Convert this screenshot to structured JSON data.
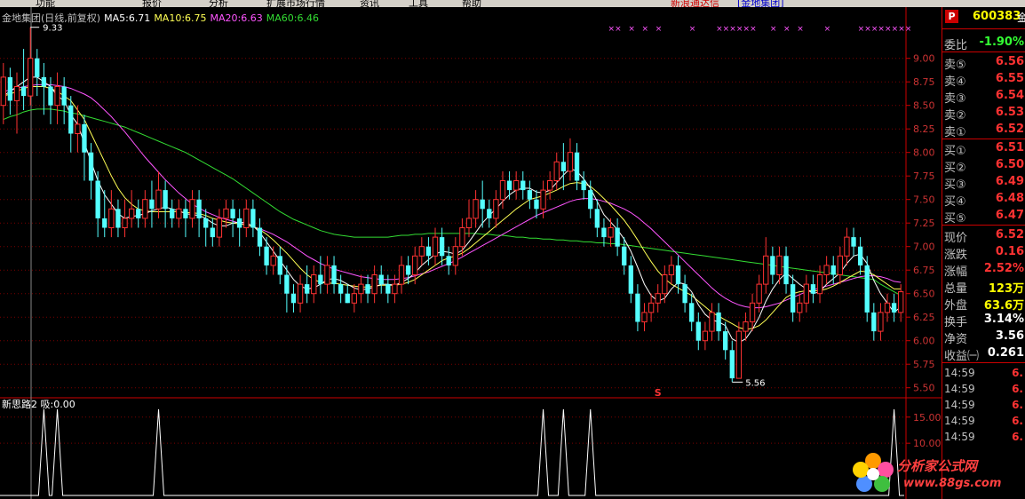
{
  "menubar": {
    "items": [
      "功能",
      "报价",
      "分析",
      "扩展市场行情",
      "资讯",
      "工具",
      "帮助"
    ],
    "notice": "新浪通达信",
    "notice2": "[金地集团]"
  },
  "chart_title": {
    "name": "金地集团(日线,前复权)",
    "ma5": "MA5:6.71",
    "ma10": "MA10:6.75",
    "ma20": "MA20:6.63",
    "ma60": "MA60:6.46"
  },
  "annotations": {
    "high_label": "9.33",
    "low_label": "5.56",
    "s_mark": "S"
  },
  "sub_title": "新思路2 吸:0.00",
  "quote": {
    "badge": "P",
    "code": "600383",
    "extra": "金",
    "wei_bi_label": "委比",
    "wei_bi_value": "-1.90%",
    "sell": [
      {
        "label": "卖⑤",
        "value": "6.56"
      },
      {
        "label": "卖④",
        "value": "6.55"
      },
      {
        "label": "卖③",
        "value": "6.54"
      },
      {
        "label": "卖②",
        "value": "6.53"
      },
      {
        "label": "卖①",
        "value": "6.52"
      }
    ],
    "buy": [
      {
        "label": "买①",
        "value": "6.51"
      },
      {
        "label": "买②",
        "value": "6.50"
      },
      {
        "label": "买③",
        "value": "6.49"
      },
      {
        "label": "买④",
        "value": "6.48"
      },
      {
        "label": "买⑤",
        "value": "6.47"
      }
    ],
    "stats": [
      {
        "label": "现价",
        "value": "6.52",
        "color": "#ff3232"
      },
      {
        "label": "涨跌",
        "value": "0.16",
        "color": "#ff3232"
      },
      {
        "label": "涨幅",
        "value": "2.52%",
        "color": "#ff3232"
      },
      {
        "label": "总量",
        "value": "123万",
        "color": "#ffff00"
      },
      {
        "label": "外盘",
        "value": "63.6万",
        "color": "#ffff00"
      },
      {
        "label": "换手",
        "value": "3.14%",
        "color": "#ffffff"
      },
      {
        "label": "净资",
        "value": "3.56",
        "color": "#ffffff"
      },
      {
        "label": "收益㈠",
        "value": "0.261",
        "color": "#ffffff"
      }
    ],
    "ticks": [
      {
        "time": "14:59",
        "price": "6."
      },
      {
        "time": "14:59",
        "price": "6."
      },
      {
        "time": "14:59",
        "price": "6."
      },
      {
        "time": "14:59",
        "price": "6."
      },
      {
        "time": "14:59",
        "price": "6."
      }
    ]
  },
  "watermark": {
    "name": "分析家公式网",
    "url": "www.88gs.com"
  },
  "chart_data": {
    "type": "candlestick",
    "price_axis": {
      "ticks": [
        "9.00",
        "8.75",
        "8.50",
        "8.25",
        "8.00",
        "7.75",
        "7.50",
        "7.25",
        "7.00",
        "6.75",
        "6.50",
        "6.25",
        "6.00",
        "5.75",
        "5.50"
      ],
      "ylim": [
        5.45,
        9.45
      ]
    },
    "indicator_axis": {
      "ticks": [
        "15.00",
        "10.00"
      ],
      "ylim": [
        0,
        17
      ]
    },
    "series_names": [
      "MA5",
      "MA10",
      "MA20",
      "MA60"
    ],
    "colors": {
      "up": "#ff3232",
      "down": "#54ffff",
      "ma5": "#ffffff",
      "ma10": "#ffff55",
      "ma20": "#ff55ff",
      "ma60": "#33dd33",
      "signal": "#ff55ff"
    },
    "candles": [
      [
        8.5,
        8.8,
        8.3,
        8.95
      ],
      [
        8.8,
        8.55,
        8.4,
        8.9
      ],
      [
        8.55,
        8.7,
        8.2,
        8.85
      ],
      [
        8.7,
        8.6,
        8.45,
        9.1
      ],
      [
        8.6,
        9.0,
        8.5,
        9.33
      ],
      [
        9.0,
        8.8,
        8.6,
        9.1
      ],
      [
        8.8,
        8.7,
        8.4,
        8.95
      ],
      [
        8.7,
        8.5,
        8.3,
        8.8
      ],
      [
        8.5,
        8.7,
        8.3,
        8.85
      ],
      [
        8.7,
        8.5,
        8.3,
        8.8
      ],
      [
        8.5,
        8.2,
        8.0,
        8.6
      ],
      [
        8.2,
        8.3,
        8.0,
        8.5
      ],
      [
        8.3,
        8.0,
        7.7,
        8.4
      ],
      [
        8.0,
        7.7,
        7.5,
        8.1
      ],
      [
        7.7,
        7.3,
        7.1,
        7.8
      ],
      [
        7.3,
        7.2,
        7.1,
        7.6
      ],
      [
        7.2,
        7.4,
        7.1,
        7.6
      ],
      [
        7.4,
        7.2,
        7.1,
        7.5
      ],
      [
        7.2,
        7.3,
        7.1,
        7.5
      ],
      [
        7.3,
        7.4,
        7.2,
        7.6
      ],
      [
        7.4,
        7.3,
        7.2,
        7.5
      ],
      [
        7.3,
        7.5,
        7.2,
        7.6
      ],
      [
        7.5,
        7.4,
        7.2,
        7.7
      ],
      [
        7.4,
        7.6,
        7.3,
        7.8
      ],
      [
        7.6,
        7.4,
        7.2,
        7.7
      ],
      [
        7.4,
        7.3,
        7.2,
        7.5
      ],
      [
        7.3,
        7.4,
        7.2,
        7.5
      ],
      [
        7.4,
        7.3,
        7.1,
        7.5
      ],
      [
        7.3,
        7.5,
        7.2,
        7.6
      ],
      [
        7.5,
        7.3,
        7.1,
        7.6
      ],
      [
        7.3,
        7.2,
        7.0,
        7.4
      ],
      [
        7.2,
        7.1,
        7.0,
        7.3
      ],
      [
        7.1,
        7.3,
        7.0,
        7.4
      ],
      [
        7.3,
        7.4,
        7.2,
        7.5
      ],
      [
        7.4,
        7.3,
        7.1,
        7.5
      ],
      [
        7.3,
        7.2,
        7.0,
        7.4
      ],
      [
        7.2,
        7.4,
        7.1,
        7.5
      ],
      [
        7.4,
        7.2,
        7.1,
        7.5
      ],
      [
        7.2,
        7.0,
        6.9,
        7.3
      ],
      [
        7.0,
        6.8,
        6.7,
        7.1
      ],
      [
        6.8,
        6.9,
        6.7,
        7.0
      ],
      [
        6.9,
        6.7,
        6.6,
        7.0
      ],
      [
        6.7,
        6.5,
        6.3,
        6.8
      ],
      [
        6.5,
        6.4,
        6.3,
        6.6
      ],
      [
        6.4,
        6.6,
        6.3,
        6.7
      ],
      [
        6.6,
        6.5,
        6.4,
        6.8
      ],
      [
        6.5,
        6.7,
        6.4,
        6.8
      ],
      [
        6.7,
        6.6,
        6.5,
        6.9
      ],
      [
        6.6,
        6.8,
        6.5,
        6.9
      ],
      [
        6.8,
        6.6,
        6.5,
        6.9
      ],
      [
        6.6,
        6.5,
        6.4,
        6.7
      ],
      [
        6.5,
        6.4,
        6.4,
        6.6
      ],
      [
        6.4,
        6.5,
        6.3,
        6.6
      ],
      [
        6.5,
        6.6,
        6.4,
        6.7
      ],
      [
        6.6,
        6.5,
        6.4,
        6.7
      ],
      [
        6.5,
        6.7,
        6.4,
        6.8
      ],
      [
        6.7,
        6.6,
        6.5,
        6.8
      ],
      [
        6.6,
        6.5,
        6.4,
        6.7
      ],
      [
        6.5,
        6.6,
        6.4,
        6.7
      ],
      [
        6.6,
        6.8,
        6.5,
        6.9
      ],
      [
        6.8,
        6.7,
        6.6,
        6.9
      ],
      [
        6.7,
        6.9,
        6.6,
        7.0
      ],
      [
        6.9,
        7.0,
        6.8,
        7.1
      ],
      [
        7.0,
        6.9,
        6.8,
        7.1
      ],
      [
        6.9,
        7.1,
        6.8,
        7.2
      ],
      [
        7.1,
        6.9,
        6.8,
        7.2
      ],
      [
        6.9,
        6.8,
        6.7,
        7.0
      ],
      [
        6.8,
        7.0,
        6.7,
        7.1
      ],
      [
        7.0,
        7.2,
        6.9,
        7.3
      ],
      [
        7.2,
        7.3,
        7.1,
        7.5
      ],
      [
        7.3,
        7.5,
        7.2,
        7.6
      ],
      [
        7.5,
        7.4,
        7.2,
        7.7
      ],
      [
        7.4,
        7.3,
        7.2,
        7.5
      ],
      [
        7.3,
        7.5,
        7.2,
        7.6
      ],
      [
        7.5,
        7.7,
        7.4,
        7.8
      ],
      [
        7.7,
        7.6,
        7.5,
        7.8
      ],
      [
        7.6,
        7.7,
        7.5,
        7.8
      ],
      [
        7.7,
        7.6,
        7.5,
        7.8
      ],
      [
        7.6,
        7.5,
        7.4,
        7.7
      ],
      [
        7.5,
        7.4,
        7.3,
        7.6
      ],
      [
        7.4,
        7.6,
        7.3,
        7.7
      ],
      [
        7.6,
        7.7,
        7.5,
        7.8
      ],
      [
        7.7,
        7.9,
        7.6,
        8.0
      ],
      [
        7.9,
        7.8,
        7.6,
        8.1
      ],
      [
        7.8,
        8.0,
        7.7,
        8.15
      ],
      [
        8.0,
        7.7,
        7.6,
        8.1
      ],
      [
        7.7,
        7.6,
        7.5,
        7.8
      ],
      [
        7.6,
        7.4,
        7.3,
        7.7
      ],
      [
        7.4,
        7.2,
        7.1,
        7.5
      ],
      [
        7.2,
        7.1,
        7.0,
        7.3
      ],
      [
        7.1,
        7.2,
        7.0,
        7.3
      ],
      [
        7.2,
        7.0,
        6.9,
        7.3
      ],
      [
        7.0,
        6.8,
        6.7,
        7.1
      ],
      [
        6.8,
        6.5,
        6.4,
        6.9
      ],
      [
        6.5,
        6.2,
        6.1,
        6.6
      ],
      [
        6.2,
        6.3,
        6.1,
        6.4
      ],
      [
        6.3,
        6.4,
        6.2,
        6.5
      ],
      [
        6.4,
        6.5,
        6.3,
        6.6
      ],
      [
        6.5,
        6.7,
        6.4,
        6.8
      ],
      [
        6.7,
        6.8,
        6.6,
        6.9
      ],
      [
        6.8,
        6.6,
        6.5,
        6.9
      ],
      [
        6.6,
        6.4,
        6.3,
        6.7
      ],
      [
        6.4,
        6.2,
        6.1,
        6.5
      ],
      [
        6.2,
        6.0,
        5.9,
        6.3
      ],
      [
        6.0,
        6.1,
        5.9,
        6.2
      ],
      [
        6.1,
        6.3,
        6.0,
        6.4
      ],
      [
        6.3,
        6.1,
        6.0,
        6.4
      ],
      [
        6.1,
        5.9,
        5.8,
        6.2
      ],
      [
        5.9,
        5.6,
        5.56,
        6.0
      ],
      [
        5.6,
        6.1,
        5.6,
        6.2
      ],
      [
        6.1,
        6.2,
        6.0,
        6.3
      ],
      [
        6.2,
        6.4,
        6.1,
        6.5
      ],
      [
        6.4,
        6.6,
        6.3,
        6.7
      ],
      [
        6.6,
        6.9,
        6.5,
        7.1
      ],
      [
        6.9,
        6.7,
        6.6,
        7.0
      ],
      [
        6.7,
        6.9,
        6.6,
        7.0
      ],
      [
        6.9,
        6.6,
        6.5,
        7.0
      ],
      [
        6.6,
        6.3,
        6.2,
        6.7
      ],
      [
        6.3,
        6.4,
        6.2,
        6.5
      ],
      [
        6.4,
        6.6,
        6.3,
        6.7
      ],
      [
        6.6,
        6.5,
        6.4,
        6.7
      ],
      [
        6.5,
        6.7,
        6.4,
        6.8
      ],
      [
        6.7,
        6.8,
        6.6,
        6.9
      ],
      [
        6.8,
        6.7,
        6.6,
        6.9
      ],
      [
        6.7,
        6.9,
        6.6,
        7.0
      ],
      [
        6.9,
        7.1,
        6.8,
        7.2
      ],
      [
        7.1,
        7.0,
        6.9,
        7.2
      ],
      [
        7.0,
        6.8,
        6.7,
        7.1
      ],
      [
        6.8,
        6.3,
        6.2,
        6.9
      ],
      [
        6.3,
        6.1,
        6.0,
        6.4
      ],
      [
        6.1,
        6.3,
        6.0,
        6.4
      ],
      [
        6.3,
        6.4,
        6.2,
        6.5
      ],
      [
        6.4,
        6.3,
        6.2,
        6.5
      ],
      [
        6.3,
        6.52,
        6.2,
        6.6
      ]
    ],
    "ma5": [
      8.6,
      8.65,
      8.7,
      8.75,
      8.8,
      8.8,
      8.75,
      8.7,
      8.6,
      8.55,
      8.4,
      8.3,
      8.1,
      7.9,
      7.7,
      7.55,
      7.45,
      7.35,
      7.3,
      7.32,
      7.33,
      7.35,
      7.38,
      7.4,
      7.42,
      7.4,
      7.38,
      7.35,
      7.34,
      7.33,
      7.3,
      7.25,
      7.22,
      7.22,
      7.25,
      7.26,
      7.25,
      7.22,
      7.15,
      7.05,
      6.95,
      6.85,
      6.75,
      6.65,
      6.58,
      6.55,
      6.56,
      6.6,
      6.65,
      6.66,
      6.64,
      6.6,
      6.56,
      6.54,
      6.55,
      6.57,
      6.6,
      6.6,
      6.59,
      6.62,
      6.66,
      6.72,
      6.8,
      6.86,
      6.92,
      6.95,
      6.94,
      6.92,
      6.96,
      7.05,
      7.15,
      7.25,
      7.33,
      7.4,
      7.48,
      7.55,
      7.6,
      7.62,
      7.62,
      7.58,
      7.57,
      7.6,
      7.68,
      7.76,
      7.83,
      7.8,
      7.72,
      7.62,
      7.48,
      7.34,
      7.26,
      7.18,
      7.08,
      6.95,
      6.78,
      6.6,
      6.48,
      6.42,
      6.45,
      6.55,
      6.62,
      6.6,
      6.52,
      6.38,
      6.28,
      6.22,
      6.2,
      6.16,
      6.02,
      5.98,
      6.02,
      6.12,
      6.25,
      6.42,
      6.55,
      6.65,
      6.72,
      6.66,
      6.6,
      6.55,
      6.5,
      6.52,
      6.6,
      6.66,
      6.72,
      6.82,
      6.9,
      6.92,
      6.82,
      6.64,
      6.5,
      6.4,
      6.3,
      6.36
    ],
    "ma10": [
      8.6,
      8.62,
      8.65,
      8.68,
      8.7,
      8.7,
      8.7,
      8.68,
      8.65,
      8.6,
      8.55,
      8.45,
      8.35,
      8.2,
      8.05,
      7.9,
      7.75,
      7.62,
      7.52,
      7.45,
      7.4,
      7.38,
      7.37,
      7.37,
      7.37,
      7.37,
      7.37,
      7.36,
      7.36,
      7.35,
      7.33,
      7.3,
      7.28,
      7.26,
      7.25,
      7.24,
      7.23,
      7.21,
      7.18,
      7.13,
      7.07,
      7.0,
      6.93,
      6.85,
      6.77,
      6.7,
      6.65,
      6.62,
      6.61,
      6.61,
      6.6,
      6.59,
      6.58,
      6.57,
      6.57,
      6.58,
      6.59,
      6.59,
      6.59,
      6.6,
      6.62,
      6.65,
      6.7,
      6.75,
      6.8,
      6.85,
      6.88,
      6.9,
      6.93,
      6.98,
      7.04,
      7.1,
      7.16,
      7.22,
      7.28,
      7.34,
      7.4,
      7.45,
      7.5,
      7.52,
      7.54,
      7.57,
      7.6,
      7.64,
      7.67,
      7.68,
      7.67,
      7.64,
      7.58,
      7.51,
      7.44,
      7.36,
      7.28,
      7.18,
      7.07,
      6.95,
      6.84,
      6.74,
      6.66,
      6.6,
      6.56,
      6.52,
      6.48,
      6.42,
      6.36,
      6.3,
      6.26,
      6.22,
      6.18,
      6.14,
      6.12,
      6.13,
      6.16,
      6.22,
      6.3,
      6.38,
      6.46,
      6.5,
      6.52,
      6.53,
      6.53,
      6.53,
      6.55,
      6.58,
      6.62,
      6.66,
      6.7,
      6.74,
      6.73,
      6.7,
      6.65,
      6.6,
      6.55,
      6.55
    ],
    "ma20": [
      8.65,
      8.66,
      8.68,
      8.7,
      8.71,
      8.72,
      8.72,
      8.72,
      8.71,
      8.7,
      8.68,
      8.65,
      8.62,
      8.58,
      8.52,
      8.45,
      8.38,
      8.3,
      8.22,
      8.13,
      8.04,
      7.95,
      7.87,
      7.79,
      7.71,
      7.64,
      7.57,
      7.51,
      7.45,
      7.41,
      7.37,
      7.34,
      7.31,
      7.29,
      7.27,
      7.25,
      7.23,
      7.21,
      7.19,
      7.16,
      7.13,
      7.09,
      7.05,
      7.0,
      6.95,
      6.9,
      6.86,
      6.82,
      6.79,
      6.76,
      6.74,
      6.72,
      6.7,
      6.68,
      6.67,
      6.66,
      6.65,
      6.65,
      6.65,
      6.66,
      6.67,
      6.69,
      6.71,
      6.73,
      6.76,
      6.79,
      6.82,
      6.85,
      6.89,
      6.93,
      6.97,
      7.01,
      7.05,
      7.09,
      7.13,
      7.17,
      7.21,
      7.25,
      7.29,
      7.33,
      7.36,
      7.39,
      7.42,
      7.45,
      7.48,
      7.5,
      7.51,
      7.51,
      7.5,
      7.48,
      7.46,
      7.43,
      7.4,
      7.36,
      7.31,
      7.25,
      7.19,
      7.12,
      7.05,
      6.98,
      6.91,
      6.84,
      6.77,
      6.7,
      6.63,
      6.56,
      6.5,
      6.45,
      6.41,
      6.38,
      6.36,
      6.35,
      6.35,
      6.36,
      6.38,
      6.4,
      6.43,
      6.46,
      6.49,
      6.52,
      6.54,
      6.56,
      6.58,
      6.6,
      6.62,
      6.64,
      6.66,
      6.68,
      6.69,
      6.69,
      6.68,
      6.66,
      6.63,
      6.62
    ],
    "ma60": [
      8.35,
      8.38,
      8.4,
      8.43,
      8.45,
      8.46,
      8.46,
      8.46,
      8.45,
      8.44,
      8.42,
      8.41,
      8.39,
      8.37,
      8.35,
      8.33,
      8.31,
      8.29,
      8.27,
      8.24,
      8.21,
      8.18,
      8.15,
      8.12,
      8.09,
      8.06,
      8.03,
      8.0,
      7.96,
      7.92,
      7.88,
      7.84,
      7.8,
      7.76,
      7.72,
      7.67,
      7.62,
      7.57,
      7.52,
      7.47,
      7.42,
      7.37,
      7.33,
      7.29,
      7.26,
      7.23,
      7.2,
      7.17,
      7.15,
      7.13,
      7.12,
      7.11,
      7.1,
      7.1,
      7.1,
      7.1,
      7.1,
      7.1,
      7.11,
      7.12,
      7.12,
      7.13,
      7.13,
      7.14,
      7.14,
      7.14,
      7.14,
      7.14,
      7.14,
      7.14,
      7.14,
      7.13,
      7.13,
      7.12,
      7.12,
      7.11,
      7.1,
      7.1,
      7.09,
      7.09,
      7.08,
      7.08,
      7.07,
      7.07,
      7.06,
      7.06,
      7.05,
      7.05,
      7.04,
      7.04,
      7.03,
      7.03,
      7.02,
      7.01,
      7.0,
      6.99,
      6.98,
      6.97,
      6.96,
      6.95,
      6.94,
      6.93,
      6.92,
      6.91,
      6.9,
      6.89,
      6.88,
      6.87,
      6.86,
      6.85,
      6.84,
      6.83,
      6.82,
      6.81,
      6.8,
      6.79,
      6.78,
      6.77,
      6.76,
      6.75,
      6.74,
      6.73,
      6.72,
      6.71,
      6.7,
      6.69,
      6.68,
      6.67,
      6.66,
      6.65,
      6.6,
      6.56,
      6.52,
      6.48
    ],
    "signal_peaks": [
      6,
      8,
      23,
      80,
      83,
      87,
      132
    ],
    "signal_value": 16.5,
    "x_markers": [
      90,
      91,
      93,
      95,
      97,
      102,
      106,
      107,
      108,
      109,
      110,
      111,
      114,
      116,
      118,
      122,
      127,
      128,
      129,
      130,
      131,
      132,
      133,
      134
    ]
  }
}
